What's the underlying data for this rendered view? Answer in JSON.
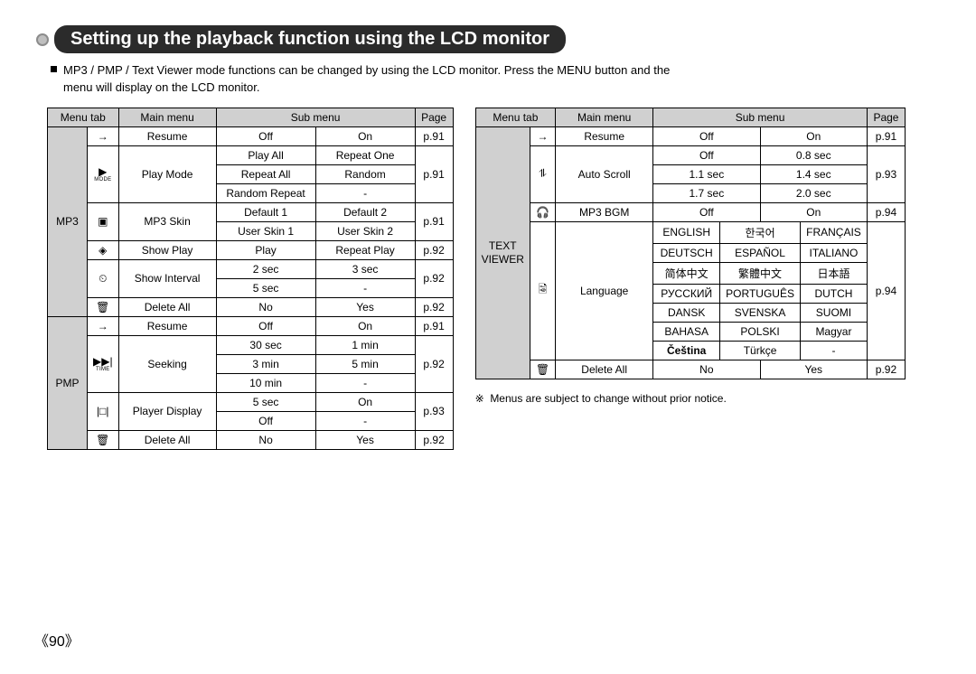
{
  "title": "Setting up the playback function using the LCD monitor",
  "intro": "MP3 / PMP / Text Viewer mode functions can be changed by using the LCD monitor. Press the MENU button and the menu will display on the LCD monitor.",
  "headers": {
    "menutab": "Menu tab",
    "mainmenu": "Main menu",
    "submenu": "Sub menu",
    "page": "Page"
  },
  "left": {
    "section1": "MP3",
    "section2": "PMP",
    "rows": {
      "resume": {
        "main": "Resume",
        "sub1": "Off",
        "sub2": "On",
        "page": "p.91"
      },
      "playmode": {
        "main": "Play Mode",
        "r1a": "Play All",
        "r1b": "Repeat One",
        "r2a": "Repeat All",
        "r2b": "Random",
        "r3a": "Random Repeat",
        "r3b": "-",
        "page": "p.91"
      },
      "mp3skin": {
        "main": "MP3 Skin",
        "r1a": "Default 1",
        "r1b": "Default 2",
        "r2a": "User Skin 1",
        "r2b": "User Skin 2",
        "page": "p.91"
      },
      "showplay": {
        "main": "Show Play",
        "sub1": "Play",
        "sub2": "Repeat Play",
        "page": "p.92"
      },
      "showinterval": {
        "main": "Show Interval",
        "r1a": "2 sec",
        "r1b": "3 sec",
        "r2a": "5 sec",
        "r2b": "-",
        "page": "p.92"
      },
      "deleteall1": {
        "main": "Delete All",
        "sub1": "No",
        "sub2": "Yes",
        "page": "p.92"
      },
      "resume2": {
        "main": "Resume",
        "sub1": "Off",
        "sub2": "On",
        "page": "p.91"
      },
      "seeking": {
        "main": "Seeking",
        "r1a": "30 sec",
        "r1b": "1 min",
        "r2a": "3 min",
        "r2b": "5 min",
        "r3a": "10 min",
        "r3b": "-",
        "page": "p.92"
      },
      "playerdisplay": {
        "main": "Player Display",
        "r1a": "5 sec",
        "r1b": "On",
        "r2a": "Off",
        "r2b": "-",
        "page": "p.93"
      },
      "deleteall2": {
        "main": "Delete All",
        "sub1": "No",
        "sub2": "Yes",
        "page": "p.92"
      }
    }
  },
  "right": {
    "section": "TEXT VIEWER",
    "rows": {
      "resume": {
        "main": "Resume",
        "sub1": "Off",
        "sub2": "On",
        "page": "p.91"
      },
      "autoscroll": {
        "main": "Auto Scroll",
        "r1a": "Off",
        "r1b": "0.8 sec",
        "r2a": "1.1 sec",
        "r2b": "1.4 sec",
        "r3a": "1.7 sec",
        "r3b": "2.0 sec",
        "page": "p.93"
      },
      "mp3bgm": {
        "main": "MP3 BGM",
        "sub1": "Off",
        "sub2": "On",
        "page": "p.94"
      },
      "language": {
        "main": "Language",
        "cells": [
          [
            "ENGLISH",
            "한국어",
            "FRANÇAIS"
          ],
          [
            "DEUTSCH",
            "ESPAÑOL",
            "ITALIANO"
          ],
          [
            "简体中文",
            "繁體中文",
            "日本語"
          ],
          [
            "РУССКИЙ",
            "PORTUGUÊS",
            "DUTCH"
          ],
          [
            "DANSK",
            "SVENSKA",
            "SUOMI"
          ],
          [
            "BAHASA",
            "POLSKI",
            "Magyar"
          ],
          [
            "Čeština",
            "Türkçe",
            "-"
          ]
        ],
        "page": "p.94"
      },
      "deleteall": {
        "main": "Delete All",
        "sub1": "No",
        "sub2": "Yes",
        "page": "p.92"
      }
    }
  },
  "notice_symbol": "※",
  "notice": "Menus are subject to change without prior notice.",
  "page_number": "《90》",
  "icons": {
    "arrow_right": "→",
    "play_mode": "▶",
    "skin": "▣",
    "show": "◈",
    "clock": "⏲",
    "trash": "🗑",
    "scroll": "⥮",
    "headphone": "🎧",
    "lang": "🗟",
    "display": "|□|",
    "seek_top": "▶▶|"
  }
}
